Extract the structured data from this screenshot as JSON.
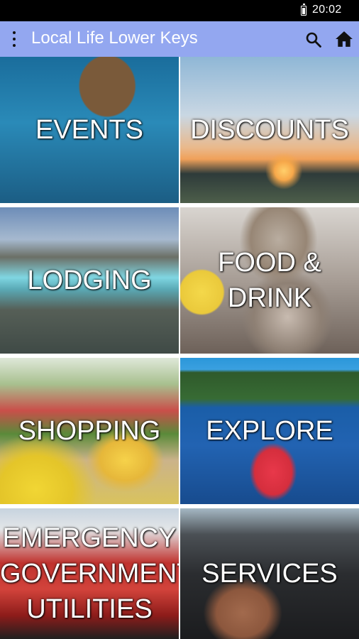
{
  "status_bar": {
    "time": "20:02"
  },
  "app_bar": {
    "title": "Local Life Lower Keys",
    "icons": [
      "menu-dots-icon",
      "search-icon",
      "home-icon"
    ],
    "background_color": "#93a7f0"
  },
  "tiles": [
    {
      "id": "events",
      "label": "EVENTS"
    },
    {
      "id": "discounts",
      "label": "DISCOUNTS"
    },
    {
      "id": "lodging",
      "label": "LODGING"
    },
    {
      "id": "food",
      "label": "FOOD &\nDRINK"
    },
    {
      "id": "shopping",
      "label": "SHOPPING"
    },
    {
      "id": "explore",
      "label": "EXPLORE"
    },
    {
      "id": "emergency",
      "label": "EMERGENCY\nGOVERNMENT\nUTILITIES"
    },
    {
      "id": "services",
      "label": "SERVICES"
    }
  ]
}
